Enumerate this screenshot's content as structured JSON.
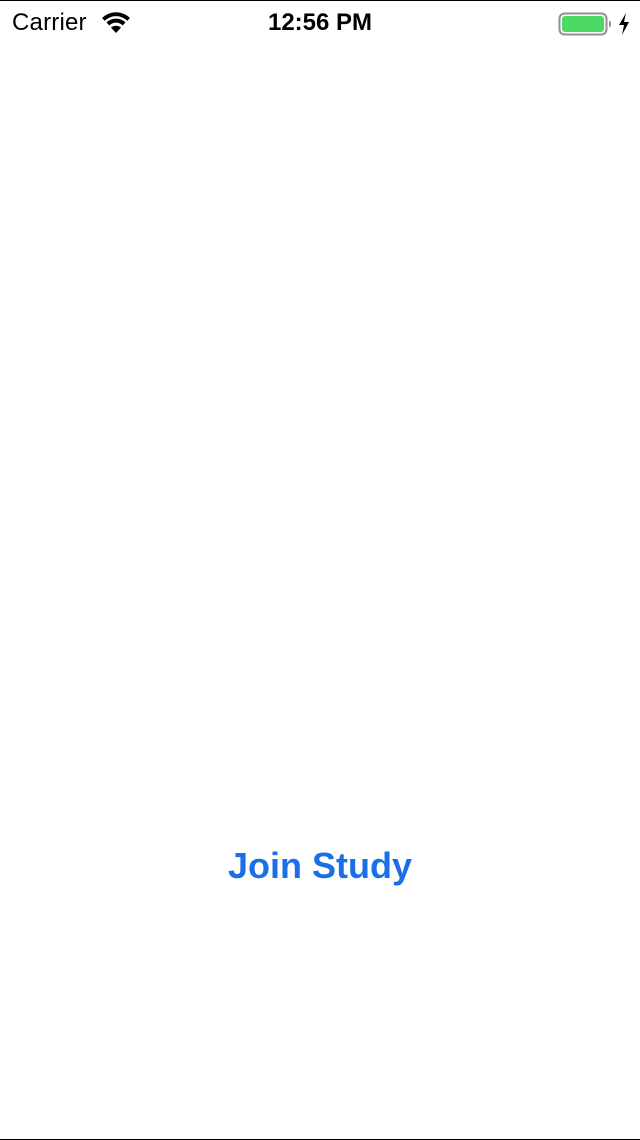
{
  "status_bar": {
    "carrier": "Carrier",
    "time": "12:56 PM",
    "wifi_icon": "wifi-icon",
    "battery_icon": "battery-icon",
    "charging_icon": "charging-bolt-icon",
    "battery_color": "#4cd964"
  },
  "main": {
    "join_label": "Join Study",
    "accent_color": "#1a6fe8"
  }
}
